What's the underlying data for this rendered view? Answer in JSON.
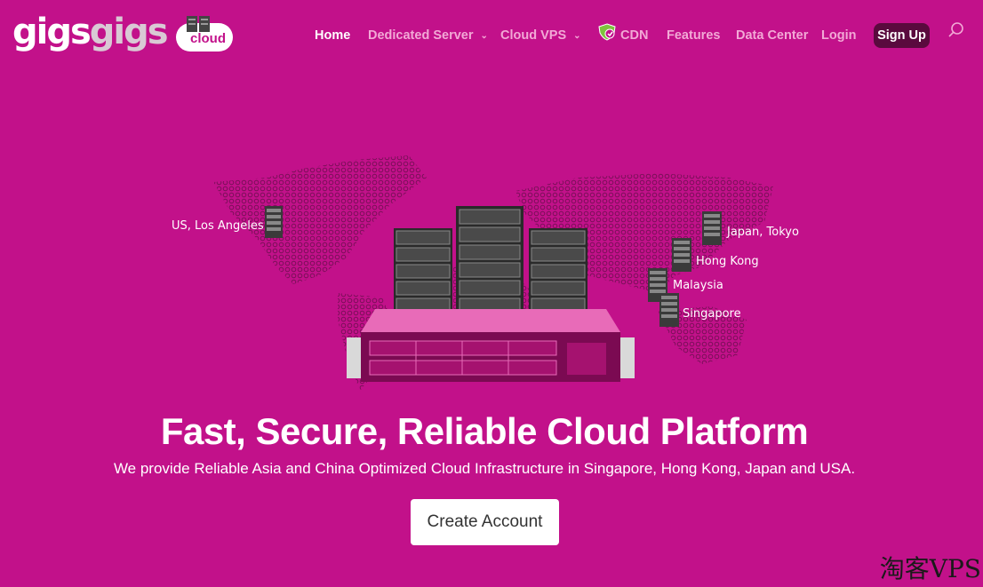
{
  "brand": {
    "logo_text_a": "gigs",
    "logo_text_b": "gigs",
    "logo_badge": "cloud"
  },
  "nav": {
    "home": "Home",
    "dedicated": "Dedicated Server",
    "cloud_vps": "Cloud VPS",
    "cdn": "CDN",
    "features": "Features",
    "data_center": "Data Center",
    "login": "Login",
    "signup": "Sign Up"
  },
  "locations": {
    "la": "US, Los Angeles",
    "tokyo": "Japan, Tokyo",
    "hongkong": "Hong Kong",
    "malaysia": "Malaysia",
    "singapore": "Singapore"
  },
  "hero": {
    "title": "Fast, Secure, Reliable Cloud Platform",
    "subtitle": "We provide Reliable Asia and China Optimized Cloud Infrastructure in Singapore, Hong Kong, Japan and USA.",
    "cta": "Create Account"
  },
  "watermark": "淘客VPS",
  "icons": {
    "search": "search-icon",
    "cdn": "shield-icon",
    "chevron": "chevron-down-icon"
  },
  "colors": {
    "background": "#c2118a",
    "signup_bg": "#5a0a3e",
    "nav_inactive": "#f2a9d6"
  }
}
